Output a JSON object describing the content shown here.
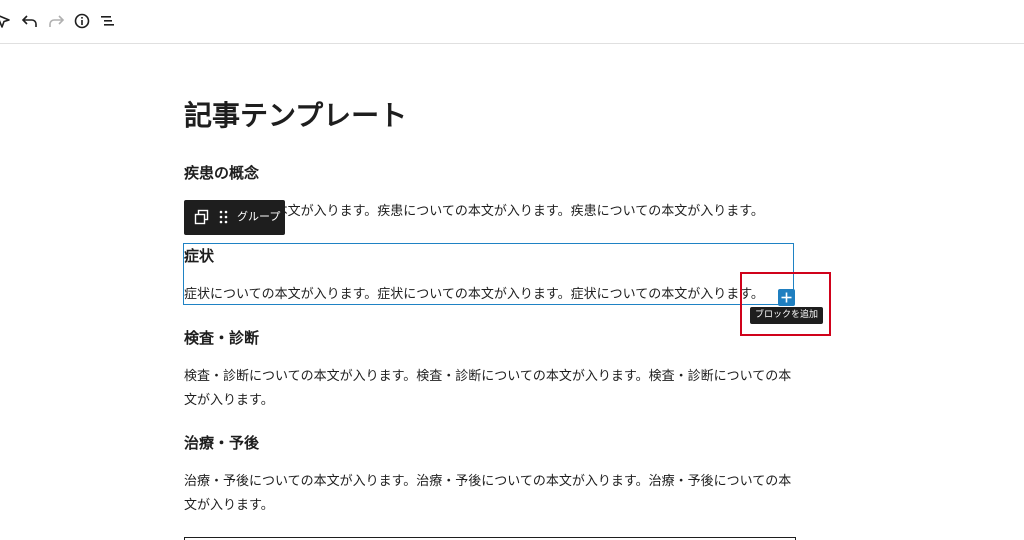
{
  "toolbar": {
    "icons": [
      "select-tool-icon",
      "undo-icon",
      "redo-icon",
      "info-icon",
      "list-view-icon"
    ]
  },
  "post": {
    "title": "記事テンプレート"
  },
  "sections": [
    {
      "heading": "疾患の概念",
      "body": "疾患についての本文が入ります。疾患についての本文が入ります。疾患についての本文が入ります。"
    },
    {
      "heading": "症状",
      "body": "症状についての本文が入ります。症状についての本文が入ります。症状についての本文が入ります。"
    },
    {
      "heading": "検査・診断",
      "body": "検査・診断についての本文が入ります。検査・診断についての本文が入ります。検査・診断についての本文が入ります。"
    },
    {
      "heading": "治療・予後",
      "body": "治療・予後についての本文が入ります。治療・予後についての本文が入ります。治療・予後についての本文が入ります。"
    }
  ],
  "block_toolbar": {
    "label": "グループ"
  },
  "add_block": {
    "tooltip": "ブロックを追加"
  },
  "colors": {
    "accent": "#1f7fc0",
    "highlight": "#d0021b",
    "dark": "#1e1e1e"
  }
}
